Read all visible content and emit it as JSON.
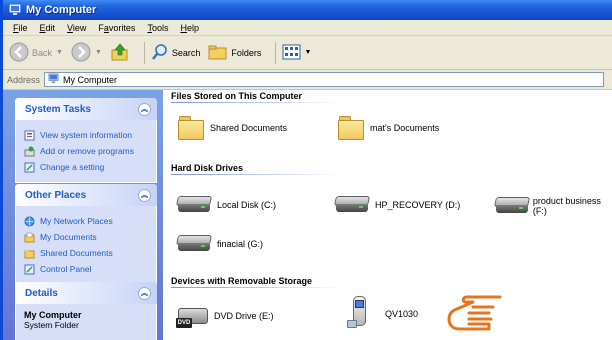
{
  "window": {
    "title": "My Computer",
    "title_icon": "my-computer-icon"
  },
  "menu": [
    {
      "underline": "F",
      "rest": "ile"
    },
    {
      "underline": "E",
      "rest": "dit"
    },
    {
      "underline": "V",
      "rest": "iew"
    },
    {
      "prefix": "F",
      "underline": "a",
      "rest": "vorites"
    },
    {
      "underline": "T",
      "rest": "ools"
    },
    {
      "underline": "H",
      "rest": "elp"
    }
  ],
  "toolbar": {
    "back": "Back",
    "search": "Search",
    "folders": "Folders"
  },
  "address": {
    "label": "Address",
    "value": "My Computer"
  },
  "sidebar": {
    "system_tasks": {
      "title": "System Tasks",
      "items": [
        "View system information",
        "Add or remove programs",
        "Change a setting"
      ]
    },
    "other_places": {
      "title": "Other Places",
      "items": [
        "My Network Places",
        "My Documents",
        "Shared Documents",
        "Control Panel"
      ]
    },
    "details": {
      "title": "Details",
      "name": "My Computer",
      "type": "System Folder"
    }
  },
  "content": {
    "groups": {
      "files": "Files Stored on This Computer",
      "hdd": "Hard Disk Drives",
      "removable": "Devices with Removable Storage"
    },
    "files": [
      "Shared Documents",
      "mat's Documents"
    ],
    "drives": [
      "Local Disk (C:)",
      "HP_RECOVERY (D:)",
      "product business (F:)",
      "finacial (G:)"
    ],
    "removable": [
      "DVD Drive (E:)",
      "QV1030"
    ],
    "dvd_badge": "DVD"
  },
  "colors": {
    "titlebar": "#1652d2",
    "sidebar": "#6f8fe0",
    "link": "#215dc6",
    "pointer": "#e8731e"
  }
}
